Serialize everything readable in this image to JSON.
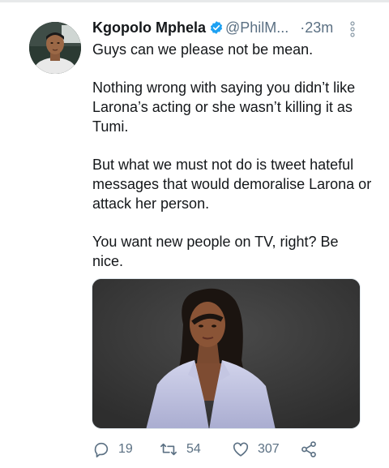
{
  "tweet": {
    "author": {
      "display_name": "Kgopolo Mphela",
      "handle": "@PhilM...",
      "verified": true
    },
    "separator": "·",
    "time": "23m",
    "text": [
      "Guys can we please not be mean.",
      "Nothing wrong with saying you didn’t like Larona’s acting or she wasn’t killing it as Tumi.",
      "But what we must not do is tweet hateful messages that would demoralise Larona or attack her person.",
      "You want new people on TV, right? Be nice."
    ],
    "actions": {
      "replies": "19",
      "retweets": "54",
      "likes": "307"
    }
  },
  "icons": {
    "verified": "verified-badge-icon",
    "more": "vertical-ellipsis-icon",
    "reply": "reply-icon",
    "retweet": "retweet-icon",
    "like": "heart-icon",
    "share": "share-icon"
  },
  "colors": {
    "accent": "#1da1f2",
    "text": "#14171a",
    "secondary": "#5b7083"
  }
}
